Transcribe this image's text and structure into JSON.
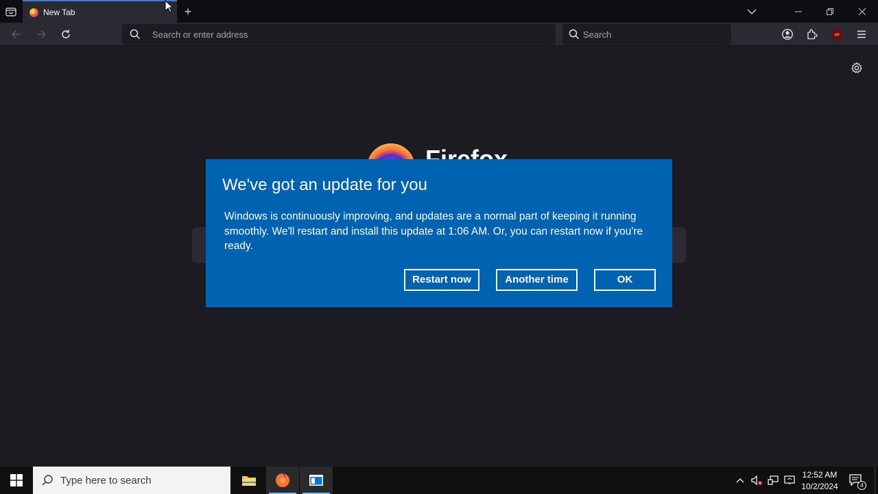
{
  "browser": {
    "tab": {
      "title": "New Tab"
    },
    "urlbar": {
      "placeholder": "Search or enter address"
    },
    "searchbar": {
      "placeholder": "Search"
    },
    "extension_badge": "uO"
  },
  "newtab": {
    "wordmark": "Firefox"
  },
  "dialog": {
    "heading": "We've got an update for you",
    "body": "Windows is continuously improving, and updates are a normal part of keeping it running smoothly. We'll restart and install this update at 1:06 AM. Or, you can restart now if you're ready.",
    "buttons": {
      "restart_now": "Restart now",
      "another_time": "Another time",
      "ok": "OK"
    }
  },
  "taskbar": {
    "search_placeholder": "Type here to search",
    "clock": {
      "time": "12:52 AM",
      "date": "10/2/2024"
    },
    "notification_count": "4"
  },
  "colors": {
    "dialog_bg": "#0063b1",
    "browser_bg": "#1c1b22",
    "toolbar_bg": "#2b2a33",
    "taskbar_bg": "#101010"
  }
}
